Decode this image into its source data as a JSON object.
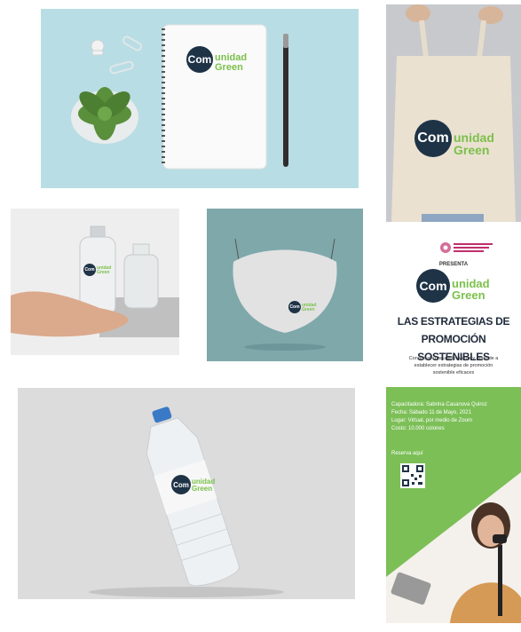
{
  "brand": {
    "circle_text": "Com",
    "rest_line1": "unidad",
    "rest_line2": "Green",
    "navy": "#1f3347",
    "green": "#7cc04b"
  },
  "flyer": {
    "organizer_logo": "decorative-logo",
    "presenta": "PRESENTA",
    "title_line1": "LAS ESTRATEGIAS DE",
    "title_line2": "PROMOCIÓN SOSTENIBLES",
    "desc_line1": "Conoce al consumidor verde y aprende a",
    "desc_line2": "establecer estrategias de promoción",
    "desc_line3": "sostenible eficaces",
    "info_line1": "Capacitadora: Sabrina Casanova Quiroz",
    "info_line2": "Fecha: Sábado 11 de Mayo, 2021",
    "info_line3": "Lugar: Virtual, por medio de Zoom",
    "info_line4": "Costo: 10.000 colones",
    "reserva": "Reserva aquí",
    "panel_green": "#7cbf57"
  },
  "icons": [
    "qr-code-icon",
    "pushpin-icon",
    "paperclip-icon",
    "pen-icon",
    "plant-icon"
  ]
}
